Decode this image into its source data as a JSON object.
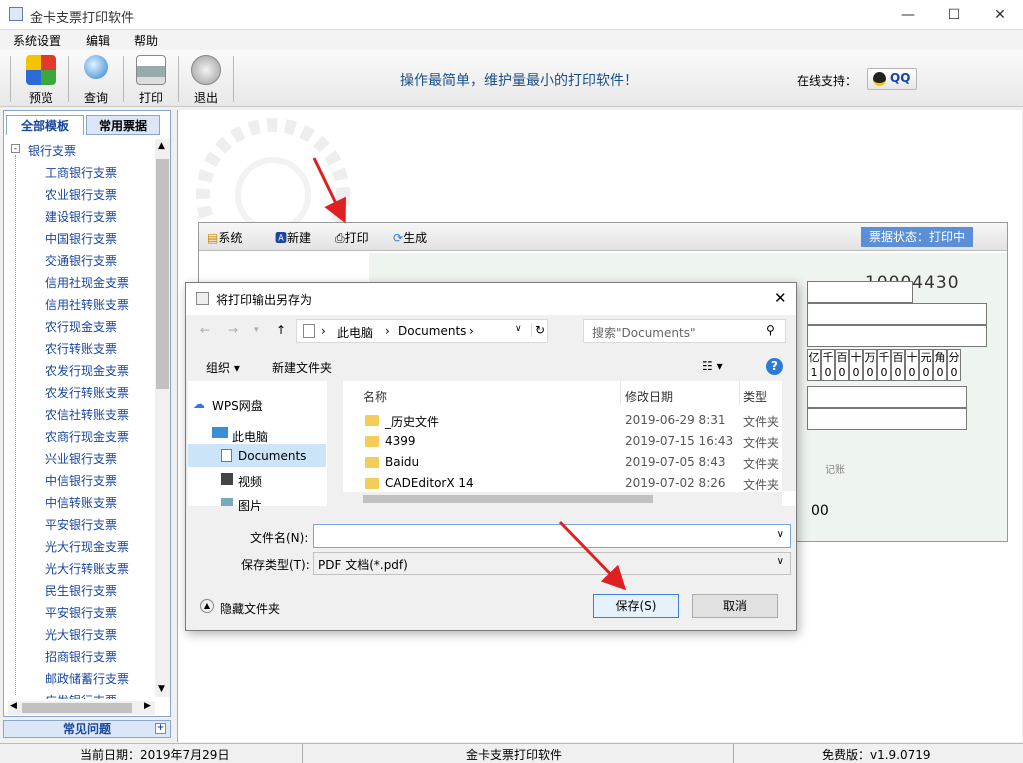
{
  "window": {
    "title": "金卡支票打印软件"
  },
  "menu": [
    "系统设置",
    "编辑",
    "帮助"
  ],
  "toolbar": {
    "buttons": [
      "预览",
      "查询",
      "打印",
      "退出"
    ],
    "slogan": "操作最简单，维护量最小的打印软件！",
    "online_label": "在线支持：",
    "qq_label": "QQ"
  },
  "leftpanel": {
    "tabs": [
      "全部模板",
      "常用票据"
    ],
    "root": "银行支票",
    "items": [
      "工商银行支票",
      "农业银行支票",
      "建设银行支票",
      "中国银行支票",
      "交通银行支票",
      "信用社现金支票",
      "信用社转账支票",
      "农行现金支票",
      "农行转账支票",
      "农发行现金支票",
      "农发行转账支票",
      "农信社转账支票",
      "农商行现金支票",
      "兴业银行支票",
      "中信银行支票",
      "中信转账支票",
      "平安银行支票",
      "光大行现金支票",
      "光大行转账支票",
      "民生银行支票",
      "平安银行支票",
      "光大银行支票",
      "招商银行支票",
      "邮政储蓄行支票",
      "广发银行支票"
    ],
    "faq": "常见问题"
  },
  "checkwin": {
    "buttons": [
      "系统",
      "新建",
      "打印",
      "生成"
    ],
    "status": "票据状态：打印中",
    "number": "10004430",
    "amount_units": [
      "亿",
      "千",
      "百",
      "十",
      "万",
      "千",
      "百",
      "十",
      "元",
      "角",
      "分"
    ],
    "amount_digits": [
      "1",
      "0",
      "0",
      "0",
      "0",
      "0",
      "0",
      "0",
      "0",
      "0",
      "0"
    ],
    "extra": "00",
    "memo": "记账"
  },
  "dialog": {
    "title": "将打印输出另存为",
    "breadcrumb": [
      "此电脑",
      "Documents"
    ],
    "search_placeholder": "搜索\"Documents\"",
    "organize": "组织 ▾",
    "new_folder": "新建文件夹",
    "nav": [
      "WPS网盘",
      "此电脑",
      "Documents",
      "视频",
      "图片"
    ],
    "columns": [
      "名称",
      "修改日期",
      "类型"
    ],
    "files": [
      {
        "name": "_历史文件",
        "date": "2019-06-29 8:31",
        "type": "文件夹"
      },
      {
        "name": "4399",
        "date": "2019-07-15 16:43",
        "type": "文件夹"
      },
      {
        "name": "Baidu",
        "date": "2019-07-05 8:43",
        "type": "文件夹"
      },
      {
        "name": "CADEditorX 14",
        "date": "2019-07-02 8:26",
        "type": "文件夹"
      }
    ],
    "filename_label": "文件名(N):",
    "filename_value": "",
    "filetype_label": "保存类型(T):",
    "filetype_value": "PDF 文档(*.pdf)",
    "hide_folders": "隐藏文件夹",
    "save": "保存(S)",
    "cancel": "取消"
  },
  "statusbar": {
    "date": "当前日期：2019年7月29日",
    "app": "金卡支票打印软件",
    "version": "免费版：v1.9.0719"
  }
}
